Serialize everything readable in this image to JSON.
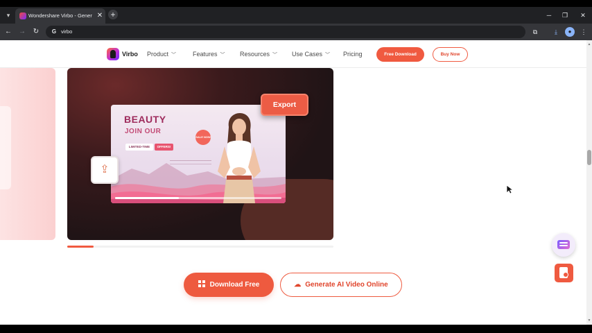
{
  "browser": {
    "tab_title": "Wondershare Virbo - Generate",
    "new_tab_symbol": "+",
    "close_symbol": "✕",
    "address": "virbo"
  },
  "site": {
    "brand": "Virbo",
    "menu": [
      {
        "label": "Product"
      },
      {
        "label": "Features"
      },
      {
        "label": "Resources"
      },
      {
        "label": "Use Cases"
      },
      {
        "label": "Pricing"
      }
    ],
    "free_download_label": "Free Download",
    "buy_now_label": "Buy Now"
  },
  "hero": {
    "mock_title_1": "BEAUTY",
    "mock_title_2": "JOIN OUR",
    "chip_limited": "LIMITED-TIME",
    "chip_offers": "OFFERS!",
    "badge": "SALE NOW",
    "export_label": "Export",
    "carousel_progress": 0.1
  },
  "cta": {
    "download_label": "Download Free",
    "online_label": "Generate AI Video Online"
  },
  "colors": {
    "accent": "#ee5a3f",
    "hero_bg": "#2a1719"
  }
}
